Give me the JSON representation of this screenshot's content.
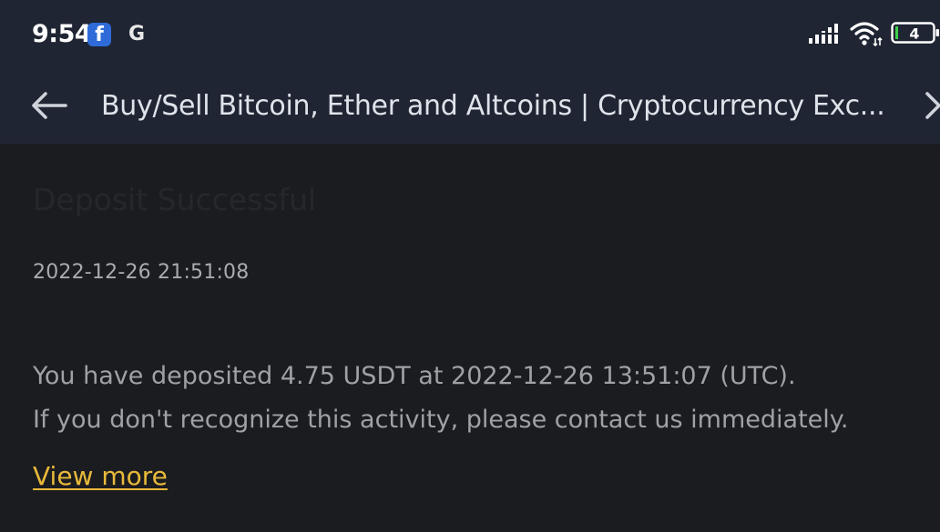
{
  "status_bar": {
    "time": "9:54",
    "notification_icons": [
      "facebook-icon",
      "google-icon"
    ],
    "battery_level": "4"
  },
  "nav": {
    "title": "Buy/Sell Bitcoin, Ether and Altcoins | Cryptocurrency Exc..."
  },
  "content": {
    "heading": "Deposit Successful",
    "timestamp": "2022-12-26 21:51:08",
    "message_line1": "You have deposited 4.75 USDT at 2022-12-26 13:51:07 (UTC).",
    "message_line2": "If you don't recognize this activity, please contact us immediately.",
    "view_more_label": "View more"
  },
  "colors": {
    "topbar_bg": "#1f2533",
    "page_bg": "#1b1c20",
    "link": "#e9b93a"
  }
}
